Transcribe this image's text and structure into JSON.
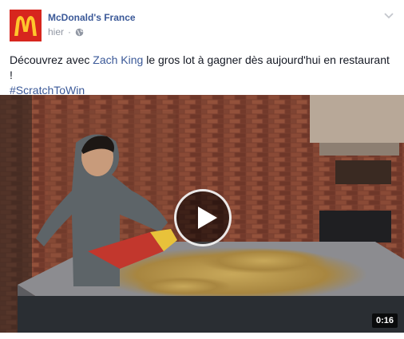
{
  "post": {
    "page_name": "McDonald's France",
    "timestamp": "hier",
    "privacy_icon": "globe-icon",
    "options_icon": "chevron-down-icon",
    "text_before": "Découvrez avec ",
    "mention": "Zach King",
    "text_after": " le gros lot à gagner dès aujourd'hui en restaurant !",
    "hashtag": "#ScratchToWin"
  },
  "video": {
    "duration": "0:16",
    "play_icon": "play-icon"
  },
  "colors": {
    "link": "#3b5998",
    "brand_red": "#d7261e",
    "brand_yellow": "#ffc72c"
  }
}
